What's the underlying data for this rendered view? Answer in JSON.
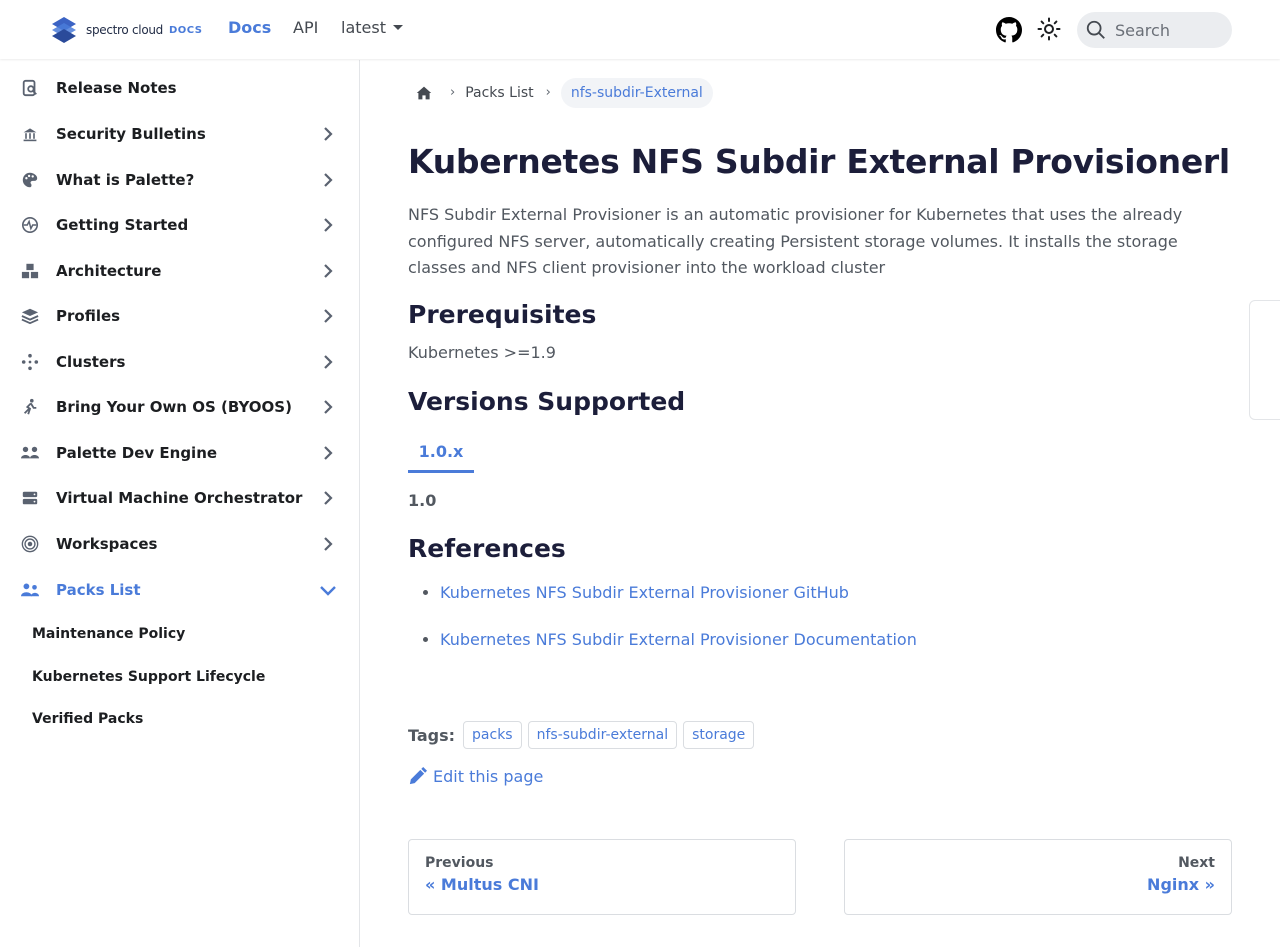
{
  "header": {
    "brand_name": "spectro cloud",
    "brand_suffix": "DOCS",
    "nav": {
      "docs": "Docs",
      "api": "API",
      "version": "latest"
    },
    "search_placeholder": "Search"
  },
  "sidebar": {
    "items": [
      {
        "label": "Release Notes",
        "icon": "release-notes-icon",
        "has_children": false
      },
      {
        "label": "Security Bulletins",
        "icon": "security-icon",
        "has_children": true
      },
      {
        "label": "What is Palette?",
        "icon": "palette-icon",
        "has_children": true
      },
      {
        "label": "Getting Started",
        "icon": "pulse-icon",
        "has_children": true
      },
      {
        "label": "Architecture",
        "icon": "cubes-icon",
        "has_children": true
      },
      {
        "label": "Profiles",
        "icon": "layers-icon",
        "has_children": true
      },
      {
        "label": "Clusters",
        "icon": "nodes-icon",
        "has_children": true
      },
      {
        "label": "Bring Your Own OS (BYOOS)",
        "icon": "person-running-icon",
        "has_children": true
      },
      {
        "label": "Palette Dev Engine",
        "icon": "people-icon",
        "has_children": true
      },
      {
        "label": "Virtual Machine Orchestrator",
        "icon": "server-icon",
        "has_children": true
      },
      {
        "label": "Workspaces",
        "icon": "target-icon",
        "has_children": true
      },
      {
        "label": "Packs List",
        "icon": "users-icon",
        "has_children": true,
        "expanded": true,
        "active": true
      }
    ],
    "sub_items": [
      "Maintenance Policy",
      "Kubernetes Support Lifecycle",
      "Verified Packs"
    ]
  },
  "breadcrumb": {
    "parent": "Packs List",
    "current": "nfs-subdir-External"
  },
  "page": {
    "title": "Kubernetes NFS Subdir External Provisionerl",
    "description": "NFS Subdir External Provisioner is an automatic provisioner for Kubernetes that uses the already configured NFS server, automatically creating Persistent storage volumes. It installs the storage classes and NFS client provisioner into the workload cluster",
    "prereq_heading": "Prerequisites",
    "prereq_text": "Kubernetes >=1.9",
    "versions_heading": "Versions Supported",
    "version_tab": "1.0.x",
    "version_content": "1.0",
    "references_heading": "References",
    "references": [
      "Kubernetes NFS Subdir External Provisioner GitHub",
      "Kubernetes NFS Subdir External Provisioner Documentation"
    ],
    "tags_label": "Tags:",
    "tags": [
      "packs",
      "nfs-subdir-external",
      "storage"
    ],
    "edit_label": "Edit this page",
    "pager": {
      "prev_sub": "Previous",
      "prev_title": "« Multus CNI",
      "next_sub": "Next",
      "next_title": "Nginx »"
    }
  },
  "colors": {
    "accent": "#4a7bd9",
    "heading": "#1c1e3a",
    "body_text": "#525860"
  }
}
